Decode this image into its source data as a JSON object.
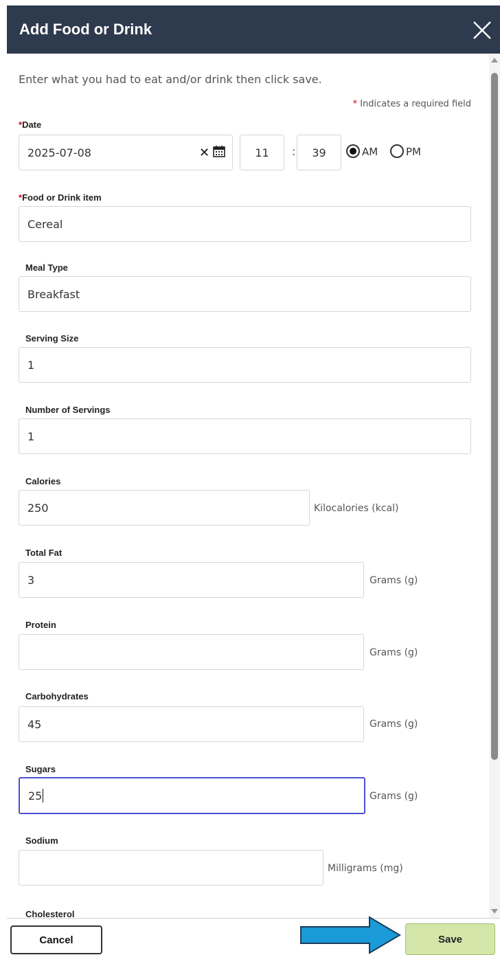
{
  "dialog": {
    "title": "Add Food or Drink"
  },
  "intro": "Enter what you had to eat and/or drink then click save.",
  "required_note": {
    "star": "*",
    "text": " Indicates a required field"
  },
  "date": {
    "label_star": "*",
    "label": "Date",
    "value": "2025-07-08",
    "clear_glyph": "✕",
    "hour": "11",
    "colon": ":",
    "minute": "39",
    "am_label": "AM",
    "pm_label": "PM",
    "selected": "AM"
  },
  "fields": {
    "food_item": {
      "label_star": "*",
      "label": "Food or Drink item",
      "value": "Cereal"
    },
    "meal_type": {
      "label": "Meal Type",
      "value": "Breakfast"
    },
    "serving_size": {
      "label": "Serving Size",
      "value": "1"
    },
    "num_servings": {
      "label": "Number of Servings",
      "value": "1"
    },
    "calories": {
      "label": "Calories",
      "value": "250",
      "unit": "Kilocalories (kcal)"
    },
    "total_fat": {
      "label": "Total Fat",
      "value": "3",
      "unit": "Grams (g)"
    },
    "protein": {
      "label": "Protein",
      "value": "",
      "unit": "Grams (g)"
    },
    "carbohydrates": {
      "label": "Carbohydrates",
      "value": "45",
      "unit": "Grams (g)"
    },
    "sugars": {
      "label": "Sugars",
      "value": "25",
      "unit": "Grams (g)"
    },
    "sodium": {
      "label": "Sodium",
      "value": "",
      "unit": "Milligrams (mg)"
    },
    "cholesterol": {
      "label": "Cholesterol"
    }
  },
  "footer": {
    "cancel_label": "Cancel",
    "save_label": "Save"
  },
  "colors": {
    "header_bg": "#2e3a4d",
    "save_bg": "#d4e6a9",
    "arrow": "#1a9ad6",
    "focus_border": "#4b4fd6",
    "required": "#d0021b"
  },
  "icons": [
    "close-icon",
    "calendar-icon",
    "clear-icon",
    "arrow-annotation-icon"
  ]
}
